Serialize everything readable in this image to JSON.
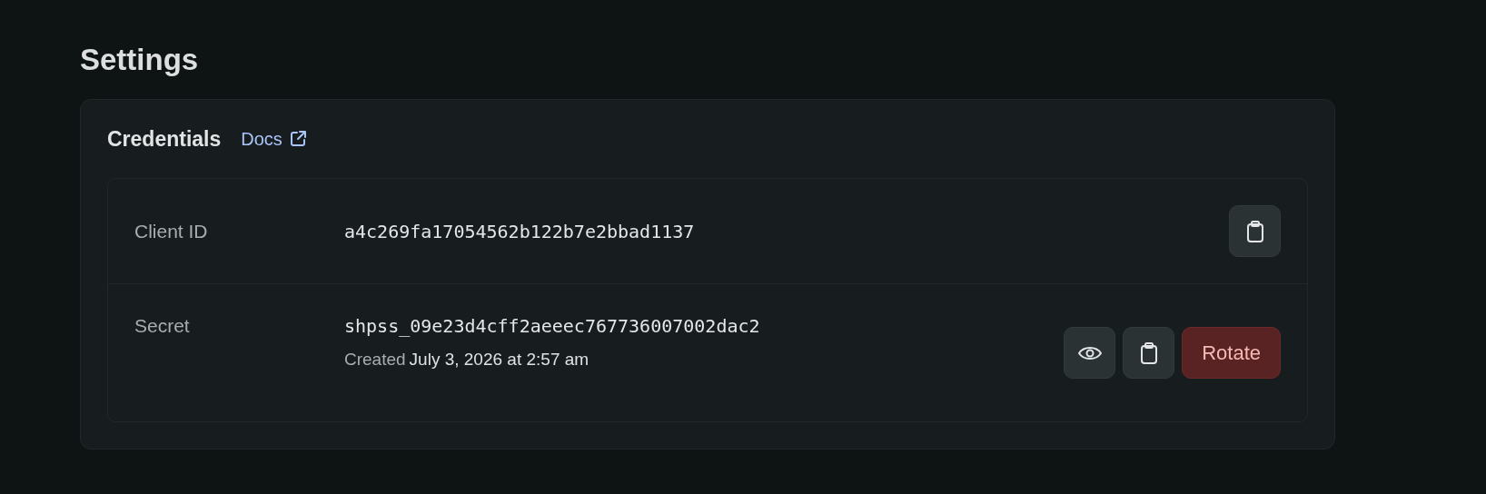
{
  "page": {
    "title": "Settings"
  },
  "credentials": {
    "title": "Credentials",
    "docs_link": "Docs",
    "rows": [
      {
        "label": "Client ID",
        "value": "a4c269fa17054562b122b7e2bbad1137",
        "actions": [
          {
            "kind": "copy"
          }
        ]
      },
      {
        "label": "Secret",
        "value": "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",
        "created_label": "Created",
        "created_at": "July 3, 2026 at 2:57 am",
        "actions": [
          {
            "kind": "reveal"
          },
          {
            "kind": "copy"
          },
          {
            "kind": "danger",
            "label": "Rotate"
          }
        ]
      }
    ]
  }
}
